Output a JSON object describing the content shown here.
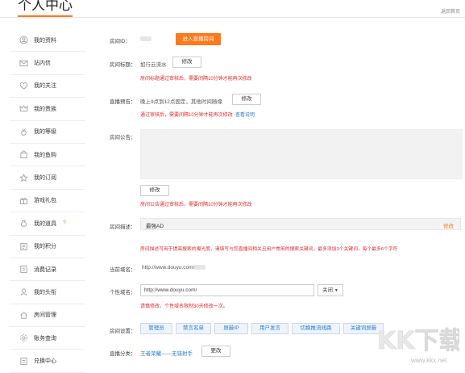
{
  "header": {
    "title": "个人中心",
    "back": "返回首页"
  },
  "sidebar": {
    "items": [
      {
        "label": "我的资料",
        "icon": "user-circle-icon"
      },
      {
        "label": "站内信",
        "icon": "mail-icon"
      },
      {
        "label": "我的关注",
        "icon": "heart-icon"
      },
      {
        "label": "我的贵族",
        "icon": "crown-icon"
      },
      {
        "label": "我的等级",
        "icon": "medal-icon"
      },
      {
        "label": "我的鱼购",
        "icon": "bag-icon"
      },
      {
        "label": "我的订阅",
        "icon": "star-icon"
      },
      {
        "label": "游戏礼包",
        "icon": "gift-icon"
      },
      {
        "label": "我的道具",
        "icon": "pouch-icon",
        "hot": "?"
      },
      {
        "label": "我的积分",
        "icon": "points-icon"
      },
      {
        "label": "消费记录",
        "icon": "record-icon"
      },
      {
        "label": "我的头衔",
        "icon": "title-icon"
      },
      {
        "label": "房间管理",
        "icon": "home-icon"
      },
      {
        "label": "账务查询",
        "icon": "gear-icon"
      },
      {
        "label": "兑换中心",
        "icon": "exchange-icon"
      }
    ]
  },
  "room": {
    "id_label": "房间ID：",
    "enter_live": "进入直播房间",
    "title_label": "房间标题：",
    "title_value": "如行云流水",
    "edit": "修改",
    "title_note": "房间标题通过审核后，需要间隔10分钟才能再次修改",
    "notice_label": "直播预告：",
    "notice_value": "晚上9点到12点固定，其他时间随缘",
    "notice_note": "通过审核后，需要间隔10分钟才能再次修改",
    "notice_link": "查看说明",
    "bulletin_label": "房间公告：",
    "bulletin_note": "房间公告通过审核后，需要间隔10分钟才能再次修改",
    "desc_label": "房间描述：",
    "desc_value": "最强AD",
    "desc_edit": "修改",
    "desc_note": "房间描述可用于提高搜索的曝光度，请填写与您直播间相关且用户常用的搜索关键词，最多添加3个关键词，每个最多6个字符",
    "domain_label": "当前域名：",
    "domain_value": "http://www.douyu.com/",
    "custom_label": "个性域名：",
    "custom_value": "http://www.douyu.com/",
    "custom_select": "关闭",
    "custom_note": "请慎修改，个性域名限制30天修改一次。",
    "settings_label": "房间设置：",
    "settings": [
      "管理员",
      "禁言名单",
      "屏蔽IP",
      "用户发言",
      "切换推流线路",
      "关键词屏蔽"
    ],
    "category_label": "直播分类：",
    "category_value": "王者荣耀——无错射手",
    "category_change": "更改"
  },
  "watermark": {
    "text": "KK下载",
    "url": "www.kkx.net"
  },
  "colors": {
    "accent": "#ff7a1a",
    "warning": "#e02b2b",
    "link": "#2b79d6"
  }
}
